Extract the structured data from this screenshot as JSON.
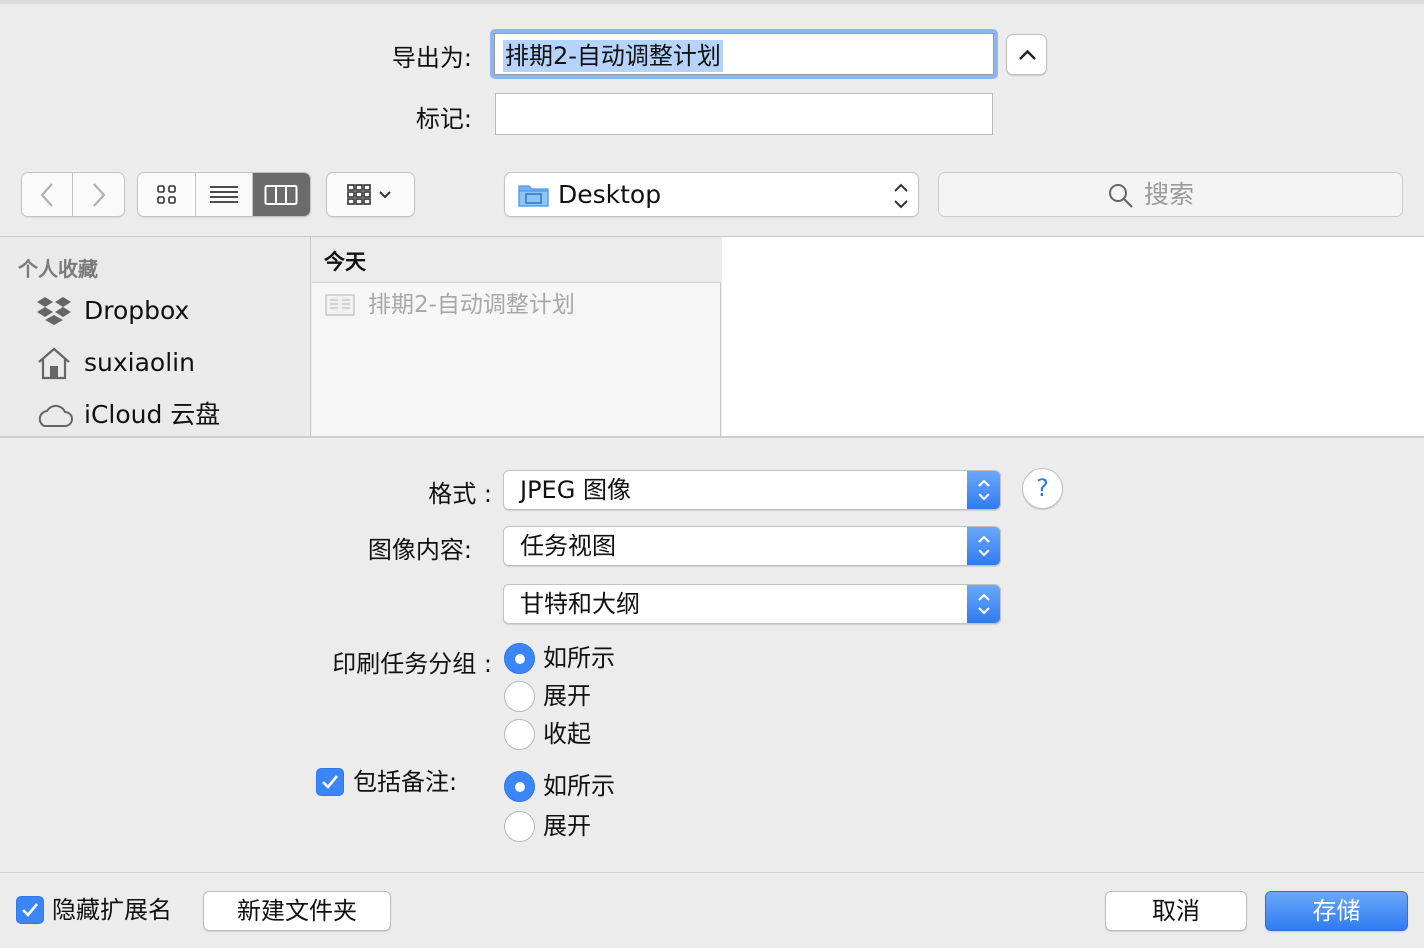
{
  "header": {
    "save_as_label": "导出为:",
    "save_as_value": "排期2-自动调整计划",
    "tags_label": "标记:",
    "tags_value": ""
  },
  "toolbar": {
    "back_icon": "chevron-left-icon",
    "forward_icon": "chevron-right-icon",
    "views": [
      "icon-view",
      "list-view",
      "column-view"
    ],
    "active_view": "column-view",
    "arrange_icon": "group-icon",
    "location": "Desktop",
    "search_placeholder": "搜索"
  },
  "sidebar": {
    "section_title": "个人收藏",
    "items": [
      {
        "label": "Dropbox",
        "icon": "dropbox-icon"
      },
      {
        "label": "suxiaolin",
        "icon": "home-icon"
      },
      {
        "label": "iCloud 云盘",
        "icon": "cloud-icon"
      }
    ]
  },
  "browser": {
    "column_header": "今天",
    "files": [
      {
        "name": "排期2-自动调整计划",
        "icon": "document-icon"
      }
    ]
  },
  "options": {
    "format_label": "格式 :",
    "format_value": "JPEG 图像",
    "image_content_label": "图像内容:",
    "image_content_value": "任务视图",
    "image_content_sub_value": "甘特和大纲",
    "print_group_label": "印刷任务分组 :",
    "print_group_options": [
      "如所示",
      "展开",
      "收起"
    ],
    "print_group_selected": 0,
    "include_notes_label": "包括备注:",
    "include_notes_checked": true,
    "include_notes_options": [
      "如所示",
      "展开"
    ],
    "include_notes_selected": 0,
    "help_label": "?"
  },
  "footer": {
    "hide_extension_label": "隐藏扩展名",
    "hide_extension_checked": true,
    "new_folder_label": "新建文件夹",
    "cancel_label": "取消",
    "save_label": "存储"
  },
  "colors": {
    "accent": "#3b86f5",
    "selection": "#b5d3fb",
    "focus_ring": "#8cb6ee"
  }
}
